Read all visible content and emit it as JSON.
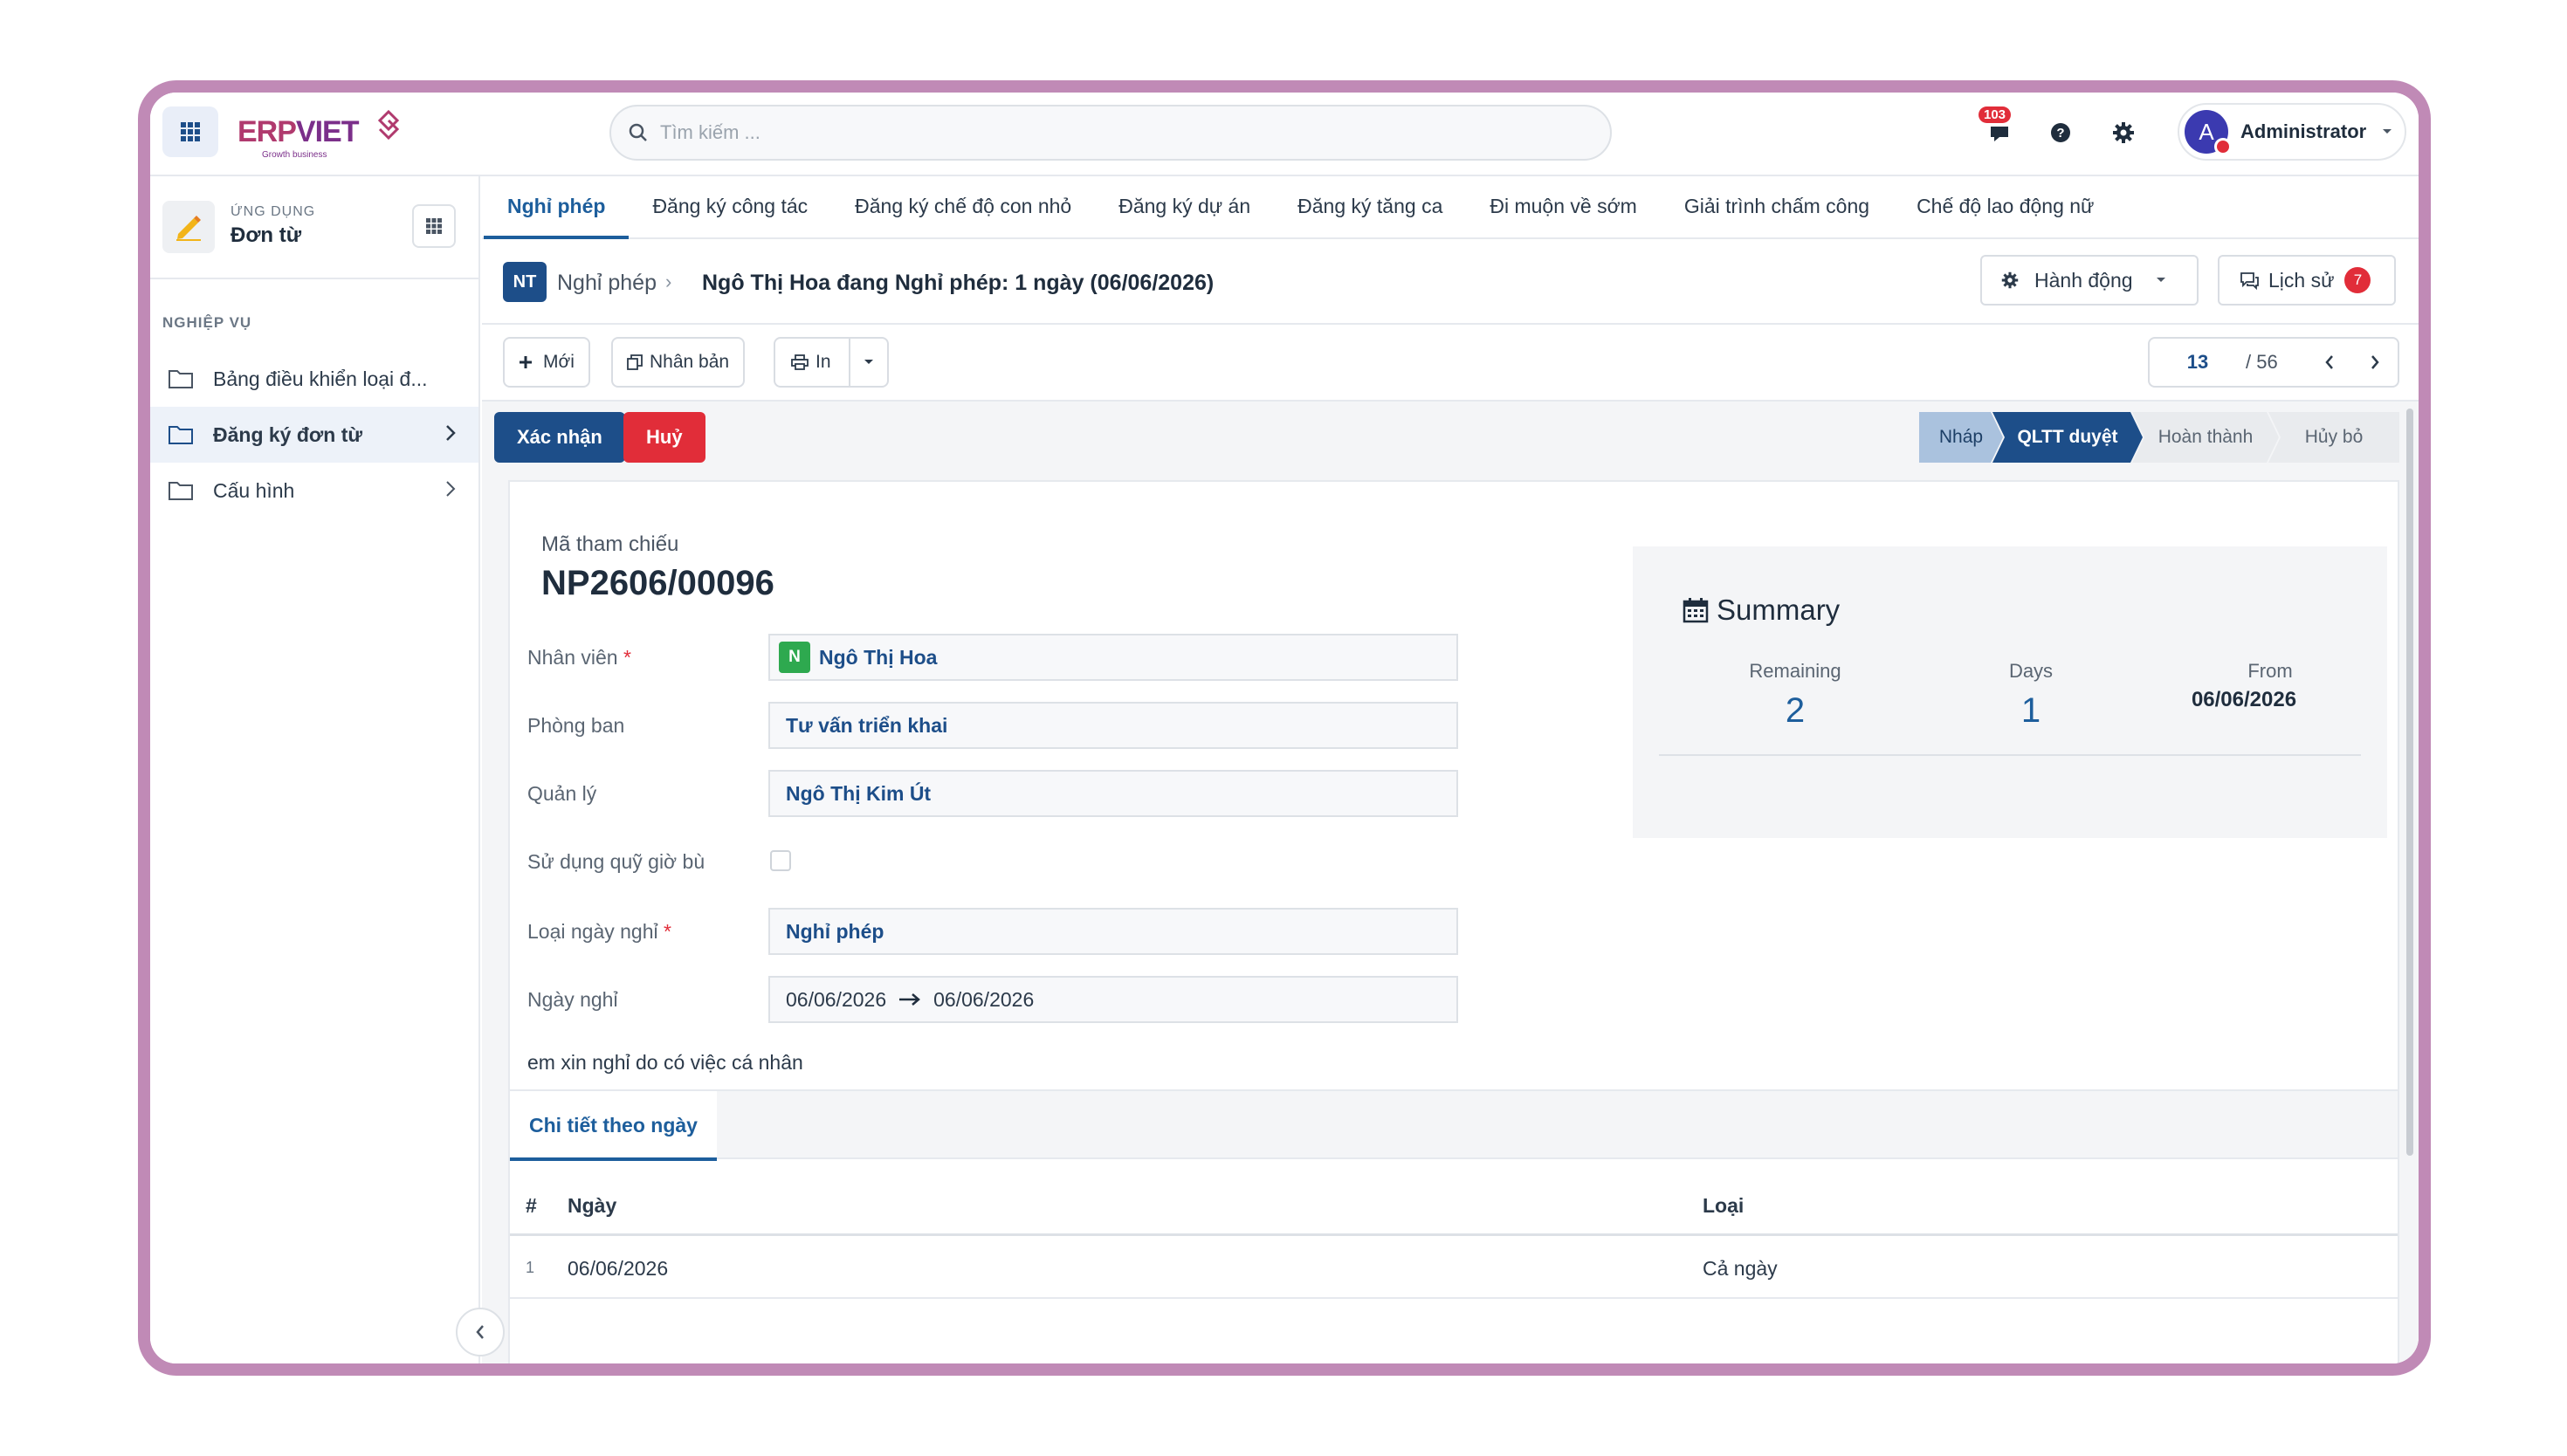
{
  "topbar": {
    "logo_erp": "ERP",
    "logo_viet": "VIET",
    "logo_tagline": "Growth business",
    "search_placeholder": "Tìm kiếm ...",
    "notification_count": "103",
    "user_initial": "A",
    "user_name": "Administrator"
  },
  "sidebar": {
    "app_label_small": "ỨNG DỤNG",
    "app_label": "Đơn từ",
    "section_title": "NGHIỆP VỤ",
    "items": [
      {
        "label": "Bảng điều khiển loại đ..."
      },
      {
        "label": "Đăng ký đơn từ"
      },
      {
        "label": "Cấu hình"
      }
    ]
  },
  "tabs": [
    {
      "label": "Nghỉ phép"
    },
    {
      "label": "Đăng ký công tác"
    },
    {
      "label": "Đăng ký chế độ con nhỏ"
    },
    {
      "label": "Đăng ký dự án"
    },
    {
      "label": "Đăng ký tăng ca"
    },
    {
      "label": "Đi muộn về sớm"
    },
    {
      "label": "Giải trình chấm công"
    },
    {
      "label": "Chế độ lao động nữ"
    }
  ],
  "breadcrumb": {
    "badge": "NT",
    "parent": "Nghỉ phép",
    "separator": "›",
    "title": "Ngô Thị Hoa đang Nghỉ phép: 1 ngày (06/06/2026)"
  },
  "actions": {
    "action_label": "Hành động",
    "history_label": "Lịch sử",
    "history_count": "7"
  },
  "toolbar": {
    "new_label": "Mới",
    "duplicate_label": "Nhân bản",
    "print_label": "In",
    "pager_current": "13",
    "pager_total": "/ 56"
  },
  "status": {
    "confirm_label": "Xác nhận",
    "cancel_label": "Huỷ",
    "stages": [
      {
        "label": "Nháp",
        "state": "done"
      },
      {
        "label": "QLTT duyệt",
        "state": "current"
      },
      {
        "label": "Hoàn thành",
        "state": "todo"
      },
      {
        "label": "Hủy bỏ",
        "state": "todo"
      }
    ]
  },
  "form": {
    "ref_label": "Mã tham chiếu",
    "ref_value": "NP2606/00096",
    "employee_label": "Nhân viên",
    "employee_badge": "N",
    "employee_value": "Ngô Thị Hoa",
    "department_label": "Phòng ban",
    "department_value": "Tư vấn triển khai",
    "manager_label": "Quản lý",
    "manager_value": "Ngô Thị Kim Út",
    "use_comp_label": "Sử dụng quỹ giờ bù",
    "leave_type_label": "Loại ngày nghỉ",
    "leave_type_value": "Nghỉ phép",
    "leave_date_label": "Ngày nghỉ",
    "date_from": "06/06/2026",
    "date_to": "06/06/2026",
    "required_mark": "*",
    "note": "em xin nghỉ do có việc cá nhân"
  },
  "summary": {
    "title": "Summary",
    "remaining_label": "Remaining",
    "remaining_value": "2",
    "days_label": "Days",
    "days_value": "1",
    "from_label": "From",
    "from_value": "06/06/2026"
  },
  "detail": {
    "tab_label": "Chi tiết theo ngày",
    "col_index": "#",
    "col_date": "Ngày",
    "col_type": "Loại",
    "rows": [
      {
        "index": "1",
        "date": "06/06/2026",
        "type": "Cả ngày"
      }
    ]
  },
  "colors": {
    "primary": "#1d4e89",
    "danger": "#e12d39",
    "frame": "#c08ab6"
  }
}
